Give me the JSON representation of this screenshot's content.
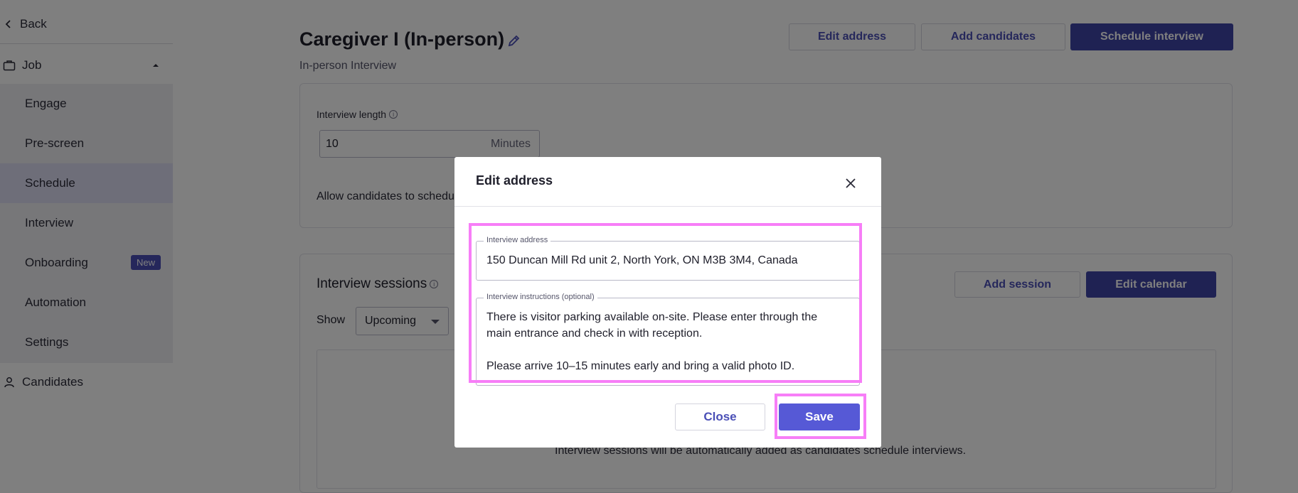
{
  "sidebar": {
    "back_label": "Back",
    "job_label": "Job",
    "items": [
      {
        "label": "Engage"
      },
      {
        "label": "Pre-screen"
      },
      {
        "label": "Schedule"
      },
      {
        "label": "Interview"
      },
      {
        "label": "Onboarding",
        "badge": "New"
      },
      {
        "label": "Automation"
      },
      {
        "label": "Settings"
      }
    ],
    "active_item": "Schedule",
    "candidates_label": "Candidates"
  },
  "header": {
    "title": "Caregiver I (In-person)",
    "subtitle": "In-person Interview",
    "edit_address_label": "Edit address",
    "add_candidates_label": "Add candidates",
    "schedule_interview_label": "Schedule interview"
  },
  "settings_card": {
    "interview_length_label": "Interview length",
    "interview_length_value": "10",
    "interview_length_unit": "Minutes",
    "allow_text": "Allow candidates to schedu"
  },
  "sessions": {
    "title": "Interview sessions",
    "add_session_label": "Add session",
    "edit_calendar_label": "Edit calendar",
    "show_label": "Show",
    "show_value": "Upcoming",
    "empty_text": "Interview sessions will be automatically added as candidates schedule interviews."
  },
  "modal": {
    "title": "Edit address",
    "address_legend": "Interview address",
    "address_value": "150 Duncan Mill Rd unit 2, North York, ON M3B 3M4, Canada",
    "instructions_legend": "Interview instructions (optional)",
    "instructions_line1": "There is visitor parking available on-site. Please enter through the",
    "instructions_line2": "main entrance and check in with reception.",
    "instructions_line3": "Please arrive 10–15 minutes early and bring a valid photo ID.",
    "close_label": "Close",
    "save_label": "Save"
  },
  "colors": {
    "primary": "#3f44a6",
    "save_button": "#5659d6",
    "highlight": "#f77ef7",
    "active_nav": "#dcdcf3"
  }
}
